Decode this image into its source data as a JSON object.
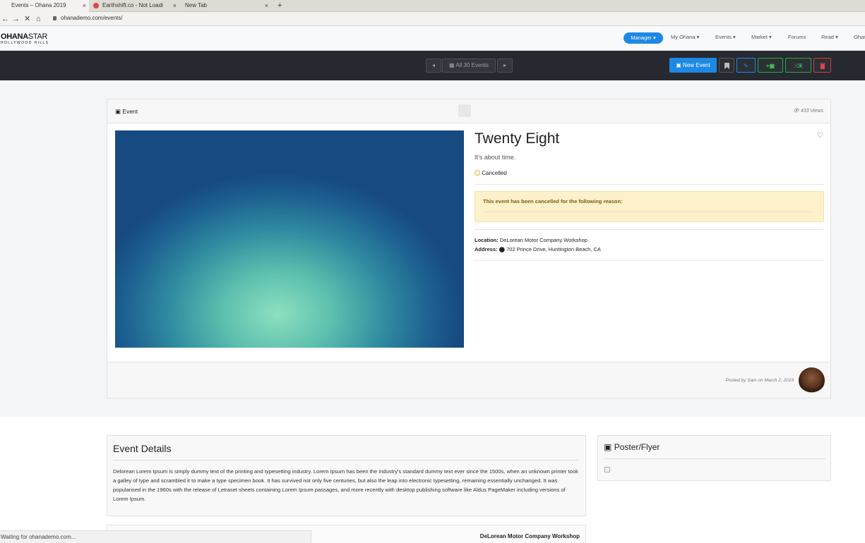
{
  "browser": {
    "tabs": [
      {
        "title": "Events – Ohana 2019",
        "close": "×"
      },
      {
        "title": "Earthshift.co - Not Loadi",
        "close": "×"
      },
      {
        "title": "New Tab",
        "close": "×"
      }
    ],
    "new_tab": "+",
    "url": "ohanademo.com/events/",
    "status": "Waiting for ohanademo.com..."
  },
  "site": {
    "logo_main_bold": "OHANA",
    "logo_main": "STAR",
    "logo_sub": "HOLLYWOOD HILLS",
    "nav": {
      "manager": "Manager ▾",
      "my_ohana": "My Ohana ▾",
      "events": "Events ▾",
      "market": "Market ▾",
      "forums": "Forums",
      "read": "Read ▾",
      "ohana": "Ohar"
    }
  },
  "toolbar": {
    "prev": "◂",
    "all_events": "All 30 Events",
    "next": "▸",
    "new_event": "New Event",
    "add_photo": "+",
    "shuffle_photo": "⤨"
  },
  "event": {
    "header_label": "Event",
    "views": "433 Views",
    "title": "Twenty Eight",
    "tagline": "It's about time.",
    "status": "Cancelled",
    "cancel_message": "This event has been cancelled for the following reason:",
    "location_label": "Location:",
    "location": "DeLorean Motor Company Workshop",
    "address_label": "Address:",
    "address": "702 Prince Drive, Huntington Beach, CA",
    "posted": "Posted by Sam on March 2, 2019"
  },
  "details": {
    "heading": "Event Details",
    "body": "Delorean Lorem Ipsum is simply dummy text of the printing and typesetting industry. Lorem Ipsum has been the industry's standard dummy text ever since the 1500s, when an unknown printer took a galley of type and scrambled it to make a type specimen book. It has survived not only five centuries, but also the leap into electronic typesetting, remaining essentially unchanged. It was popularised in the 1960s with the release of Letraset sheets containing Lorem Ipsum passages, and more recently with desktop publishing software like Aldus PageMaker including versions of Lorem Ipsum."
  },
  "poster": {
    "heading": "Poster/Flyer"
  },
  "location_card": {
    "title": "DeLorean Motor Company Workshop"
  },
  "colors": {
    "primary": "#1e88e5",
    "success": "#28a745",
    "danger": "#dc3545",
    "warning_bg": "#fdf1cc"
  }
}
